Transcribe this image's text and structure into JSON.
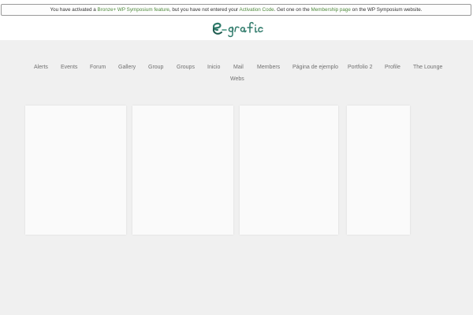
{
  "notice": {
    "prefix": "You have activated a ",
    "feature_link": "Bronze+ WP Symposium feature",
    "middle": ", but you have not entered your ",
    "activation_link": "Activation Code",
    "middle2": ". Get one on the ",
    "membership_link": "Membership page",
    "suffix": " on the WP Symposium website."
  },
  "logo": {
    "icon": "e-grafic-logo",
    "brand_color": "#2f7a6a"
  },
  "nav": {
    "items": [
      {
        "label": "Alerts"
      },
      {
        "label": "Events"
      },
      {
        "label": "Forum"
      },
      {
        "label": "Gallery"
      },
      {
        "label": "Group"
      },
      {
        "label": "Groups"
      },
      {
        "label": "Inicio"
      },
      {
        "label": "Mail"
      },
      {
        "label": "Members"
      },
      {
        "label": "Página de ejemplo"
      },
      {
        "label": "Portfolio 2"
      },
      {
        "label": "Profile"
      },
      {
        "label": "The Lounge"
      },
      {
        "label": "Webs"
      }
    ]
  },
  "colors": {
    "background": "#f0f0f0",
    "link": "#4f8a3c",
    "nav_text": "#707070"
  }
}
